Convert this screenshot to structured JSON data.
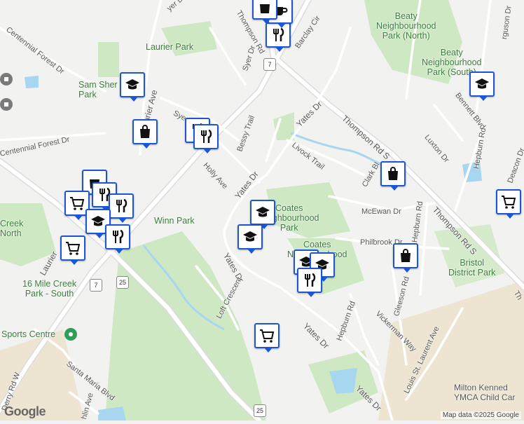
{
  "map": {
    "attribution": "Map data ©2025 Google",
    "logo": "Google",
    "colors": {
      "park": "#cfe8c4",
      "water": "#a6d6f0",
      "road": "#ffffff",
      "highway": "#e6e6e6",
      "land": "#f2f2f0",
      "marker": "#1a56d6"
    }
  },
  "streets": {
    "thompson_rd": "Thompson Rd",
    "thompson_rd_s1": "Thompson Rd S",
    "thompson_rd_s2": "Thompson Rd S",
    "laurier_ave": "Laurier Ave",
    "laurier_ave2": "Laurier",
    "centennial1": "Centennial Forest Dr",
    "centennial2": "Centennial Forest Dr",
    "syer1": "Syer Dr",
    "syer2": "Syer Dr",
    "barclay": "Barclay Cir",
    "yates1": "Yates Dr",
    "yates2": "Yates Dr",
    "yates3": "Yates Dr",
    "yates4": "Yates Dr",
    "yates5": "Yates Dr",
    "bessy": "Bessy Trail",
    "holly": "Holly Ave",
    "livock": "Livock Trail",
    "bennett": "Bennett Blvd",
    "luxton": "Luxton Dr",
    "hepburn1": "Hepburn Rd",
    "hepburn2": "Hepburn Rd",
    "hepburn3": "Hepburn Rd",
    "deacon": "Deacon Dr",
    "clark": "Clark Bl",
    "mcewan": "McEwan Dr",
    "philbrook": "Philbrook Dr",
    "gleeson": "Gleeson Rd",
    "vickerman": "Vickerman Way",
    "louis": "Louis St. Laurent Ave",
    "loft": "Loft Crescent",
    "santa_maria": "Santa Maria Blvd",
    "derry": "Derry Rd W",
    "laughlin": "hlin Ave",
    "ferguson": "rguson Dr",
    "lyer": "yer Dr",
    "th": "Th"
  },
  "places": {
    "laurier_park": "Laurier Park",
    "sam_sherratt": "Sam Sher\nPark",
    "winn_park": "Winn Park",
    "beaty_n": "Beaty\nNeighbourhood\nPark (North)",
    "beaty_s": "Beaty\nNeighbourhood\nPark (South)",
    "coates1": "Coates\nNeighbourhood\nPark",
    "coates2": "Coates\nNeighbourhood\nPark\nNorth",
    "bristol": "Bristol\nDistrict Park",
    "sixteen_mile": "16 Mile Creek\nPark - South",
    "sports_centre": "Sports Centre",
    "milton_kennedy": "Milton Kenned\nYMCA Child Car",
    "creek_north": "Creek\nNorth"
  },
  "shields": {
    "r7a": "7",
    "r7b": "7",
    "r25a": "25",
    "r25b": "25"
  }
}
